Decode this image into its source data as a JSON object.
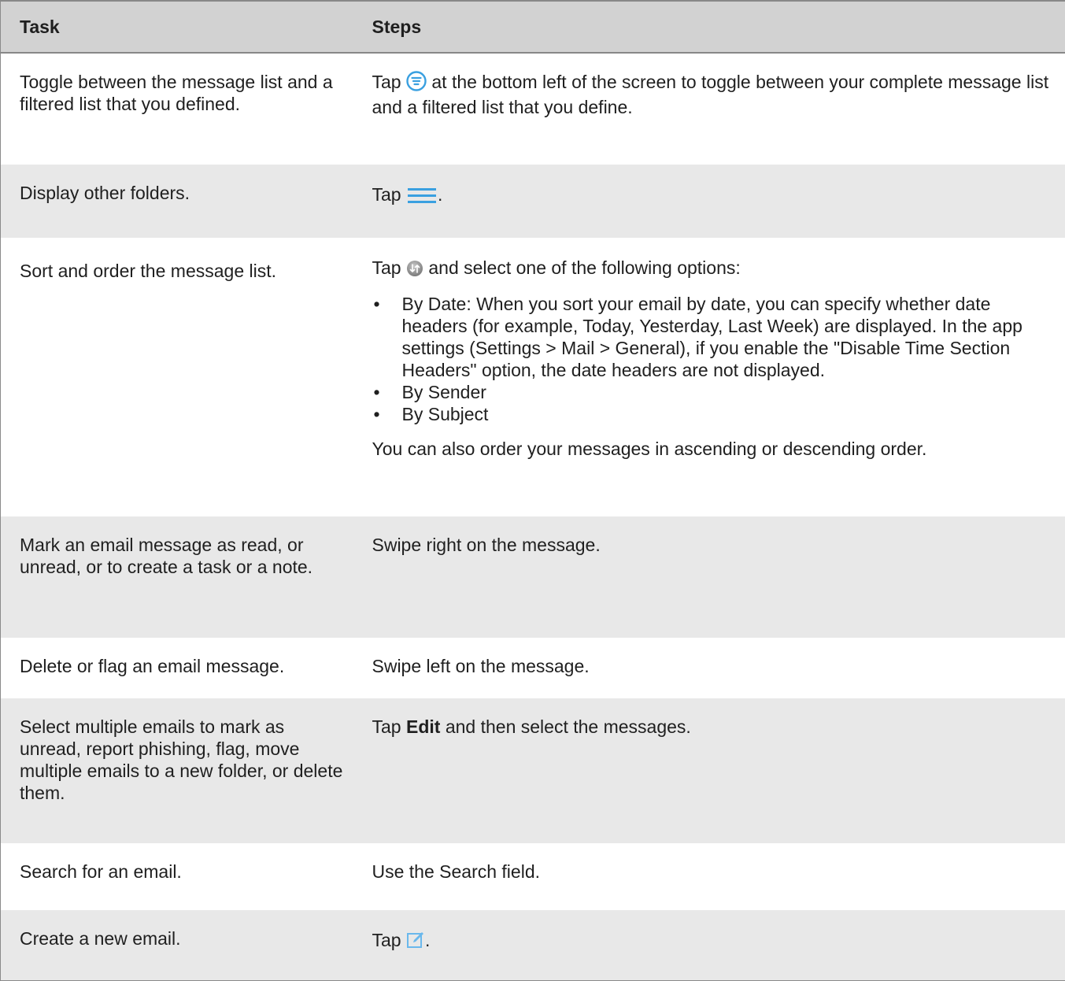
{
  "header": {
    "task": "Task",
    "steps": "Steps"
  },
  "rows": [
    {
      "task": "Toggle between the message list and a filtered list that you defined.",
      "steps_before": "Tap",
      "icon": "filter-icon",
      "steps_after": "at the bottom left of the screen to toggle between your complete message list and a filtered list that you define."
    },
    {
      "task": "Display other folders.",
      "steps_before": "Tap",
      "icon": "menu-icon",
      "steps_after": "."
    },
    {
      "task": "Sort and order the message list.",
      "steps_before": "Tap",
      "icon": "sort-icon",
      "steps_after": "and select one of the following options:",
      "bullets": [
        "By Date: When you sort your email by date, you can specify whether date headers (for example, Today, Yesterday, Last Week) are displayed. In the app settings (Settings > Mail > General), if you enable the \"Disable Time Section Headers\" option, the date headers are not displayed.",
        "By Sender",
        "By Subject"
      ],
      "bullet_char": "•",
      "steps_footer": "You can also order your messages in ascending or descending order."
    },
    {
      "task": "Mark an email message as read, or unread, or to create a task or a note.",
      "steps": "Swipe right on the message."
    },
    {
      "task": "Delete or flag an email message.",
      "steps": "Swipe left on the message."
    },
    {
      "task": "Select multiple emails to mark as unread, report phishing, flag, move multiple emails to a new folder, or delete them.",
      "steps_before": "Tap",
      "steps_bold": "Edit",
      "steps_after": "and then select the messages."
    },
    {
      "task": "Search for an email.",
      "steps": "Use the Search field."
    },
    {
      "task": "Create a new email.",
      "steps_before": "Tap",
      "icon": "compose-icon",
      "steps_after": "."
    }
  ],
  "colors": {
    "header_bg": "#d2d2d2",
    "alt_row_bg": "#e8e8e8",
    "icon_blue": "#3aa0e0"
  }
}
